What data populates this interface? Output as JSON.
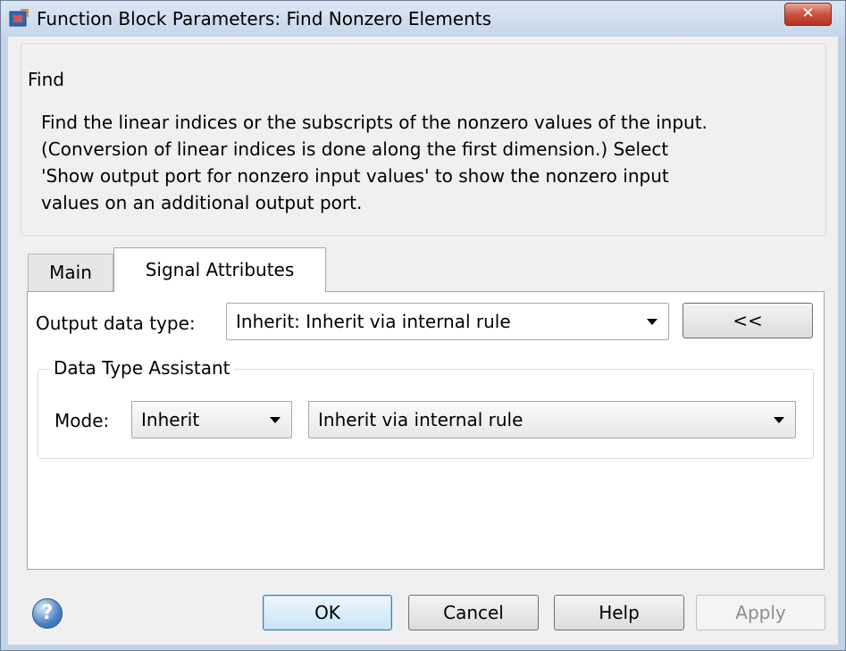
{
  "window": {
    "title": "Function Block Parameters: Find Nonzero Elements",
    "close_glyph": "✕"
  },
  "find": {
    "group_label": "Find",
    "description_lines": [
      "Find the linear indices or the subscripts of the nonzero values of the input.",
      "(Conversion of linear indices is done along the first dimension.) Select",
      "'Show output port for nonzero input values' to show the nonzero input",
      "values on an additional output port."
    ]
  },
  "tabs": [
    {
      "label": "Main",
      "active": false
    },
    {
      "label": "Signal Attributes",
      "active": true
    }
  ],
  "signal_attributes": {
    "output_data_type_label": "Output data type:",
    "output_data_type_value": "Inherit: Inherit via internal rule",
    "assistant_toggle_label": "<<",
    "assistant_group_label": "Data Type Assistant",
    "mode_label": "Mode:",
    "mode_value": "Inherit",
    "rule_value": "Inherit via internal rule"
  },
  "buttons": {
    "ok": "OK",
    "cancel": "Cancel",
    "help": "Help",
    "apply": "Apply",
    "help_icon_glyph": "?"
  },
  "colors": {
    "title_bar": "#c5d7ea",
    "close_button": "#c9523f",
    "default_button_border": "#3c7fb1"
  },
  "icons": {
    "title": "simulink-block-icon",
    "close": "close-icon",
    "help": "help-icon",
    "dropdown": "chevron-down-icon"
  }
}
